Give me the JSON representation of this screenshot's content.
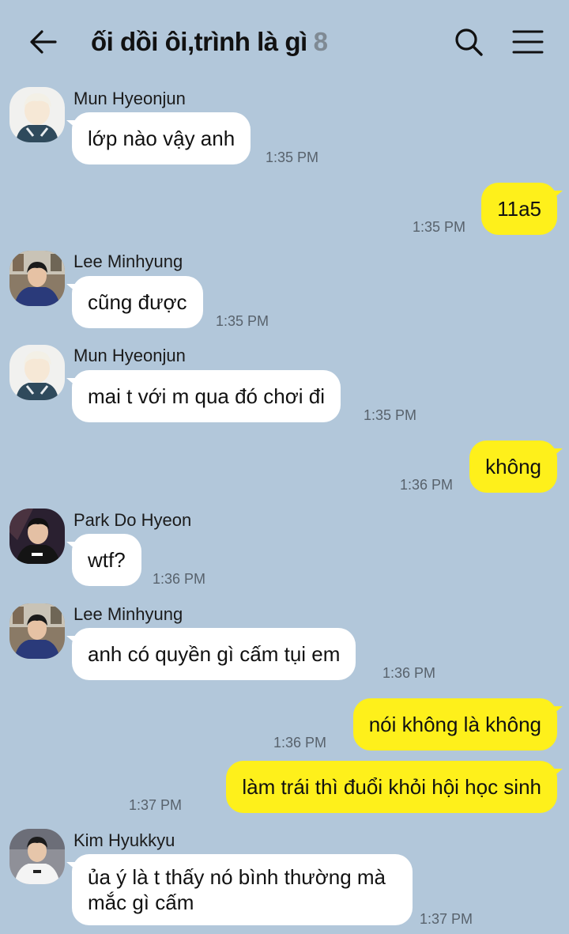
{
  "header": {
    "title": "ối dồi ôi,trình là gì",
    "member_count": "8"
  },
  "colors": {
    "background": "#b2c7da",
    "incoming_bubble": "#ffffff",
    "outgoing_bubble": "#fef01b"
  },
  "icons": {
    "back": "arrow-left-icon",
    "search": "search-icon",
    "menu": "hamburger-menu-icon"
  },
  "messages": [
    {
      "sender": "Mun Hyeonjun",
      "text": "lớp nào vậy anh",
      "time": "1:35 PM"
    },
    {
      "text": "11a5",
      "time": "1:35 PM"
    },
    {
      "sender": "Lee Minhyung",
      "text": "cũng được",
      "time": "1:35 PM"
    },
    {
      "sender": "Mun Hyeonjun",
      "text": "mai t với m qua đó chơi đi",
      "time": "1:35 PM"
    },
    {
      "text": "không",
      "time": "1:36 PM"
    },
    {
      "sender": "Park Do Hyeon",
      "text": "wtf?",
      "time": "1:36 PM"
    },
    {
      "sender": "Lee Minhyung",
      "text": "anh có quyền gì cấm tụi em",
      "time": "1:36 PM"
    },
    {
      "text": "nói không là không",
      "time": "1:36 PM"
    },
    {
      "text": "làm trái thì đuổi khỏi hội học sinh",
      "time": "1:37 PM"
    },
    {
      "sender": "Kim Hyukkyu",
      "text": "ủa ý là t thấy nó bình thường mà mắc gì cấm",
      "time": "1:37 PM"
    }
  ]
}
